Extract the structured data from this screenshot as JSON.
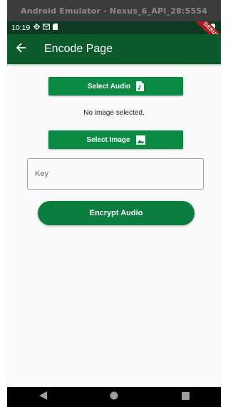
{
  "emulator": {
    "window_title": "Android Emulator - Nexus_6_API_28:5554"
  },
  "status_bar": {
    "time": "10:19",
    "icons_left": [
      "settings-icon",
      "mail-icon",
      "sd-card-icon"
    ],
    "icons_right": [
      "wifi-icon",
      "battery-icon"
    ]
  },
  "debug_banner": {
    "label": "DEBUG"
  },
  "app_bar": {
    "back_icon": "arrow-back-icon",
    "title": "Encode Page"
  },
  "main": {
    "select_audio_label": "Select Audio",
    "select_audio_icon": "audio-file-icon",
    "image_status": "No image selected.",
    "select_image_label": "Select Image",
    "select_image_icon": "image-icon",
    "key_placeholder": "Key",
    "key_value": "",
    "encrypt_label": "Encrypt Audio"
  },
  "nav_bar": {
    "items": [
      "back-nav-icon",
      "home-nav-icon",
      "recents-nav-icon"
    ]
  },
  "colors": {
    "app_bar": "#0d5a2c",
    "status_bar": "#0c3b22",
    "button": "#0b8a44",
    "pill_button": "#0b7d3f",
    "debug_ribbon": "#b01c1c"
  }
}
